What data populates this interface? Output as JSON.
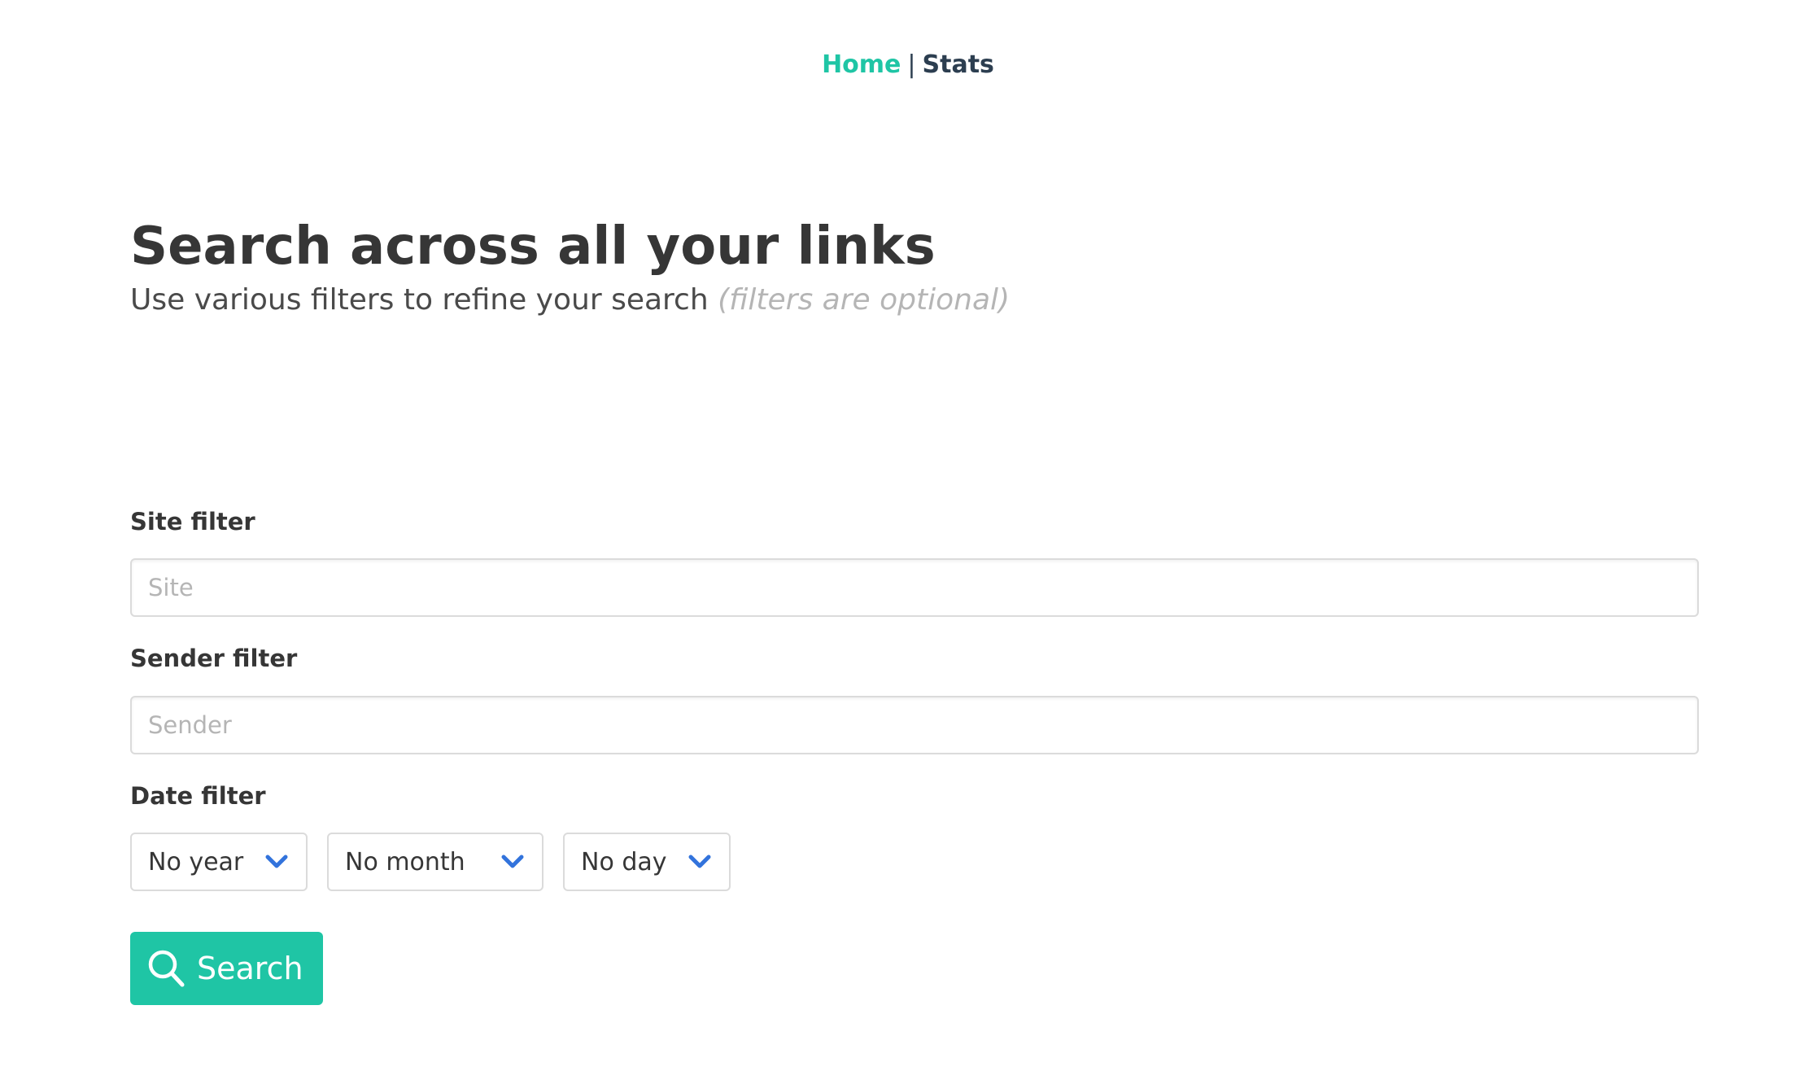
{
  "nav": {
    "home_label": "Home",
    "separator": "|",
    "stats_label": "Stats"
  },
  "hero": {
    "title": "Search across all your links",
    "subtitle": "Use various filters to refine your search",
    "subtitle_hint": "(filters are optional)"
  },
  "form": {
    "site": {
      "label": "Site filter",
      "placeholder": "Site",
      "value": ""
    },
    "sender": {
      "label": "Sender filter",
      "placeholder": "Sender",
      "value": ""
    },
    "date": {
      "label": "Date filter",
      "year_selected": "No year",
      "month_selected": "No month",
      "day_selected": "No day"
    },
    "search_button_label": "Search",
    "search_button_icon": "search-icon",
    "chevron_icon": "chevron-down-icon"
  },
  "colors": {
    "accent": "#1fc5a5",
    "dark_text": "#363636",
    "nav_dark": "#2c3e50",
    "muted_text": "#b5b5b5",
    "chevron": "#3273dc",
    "border": "#dbdbdb"
  }
}
